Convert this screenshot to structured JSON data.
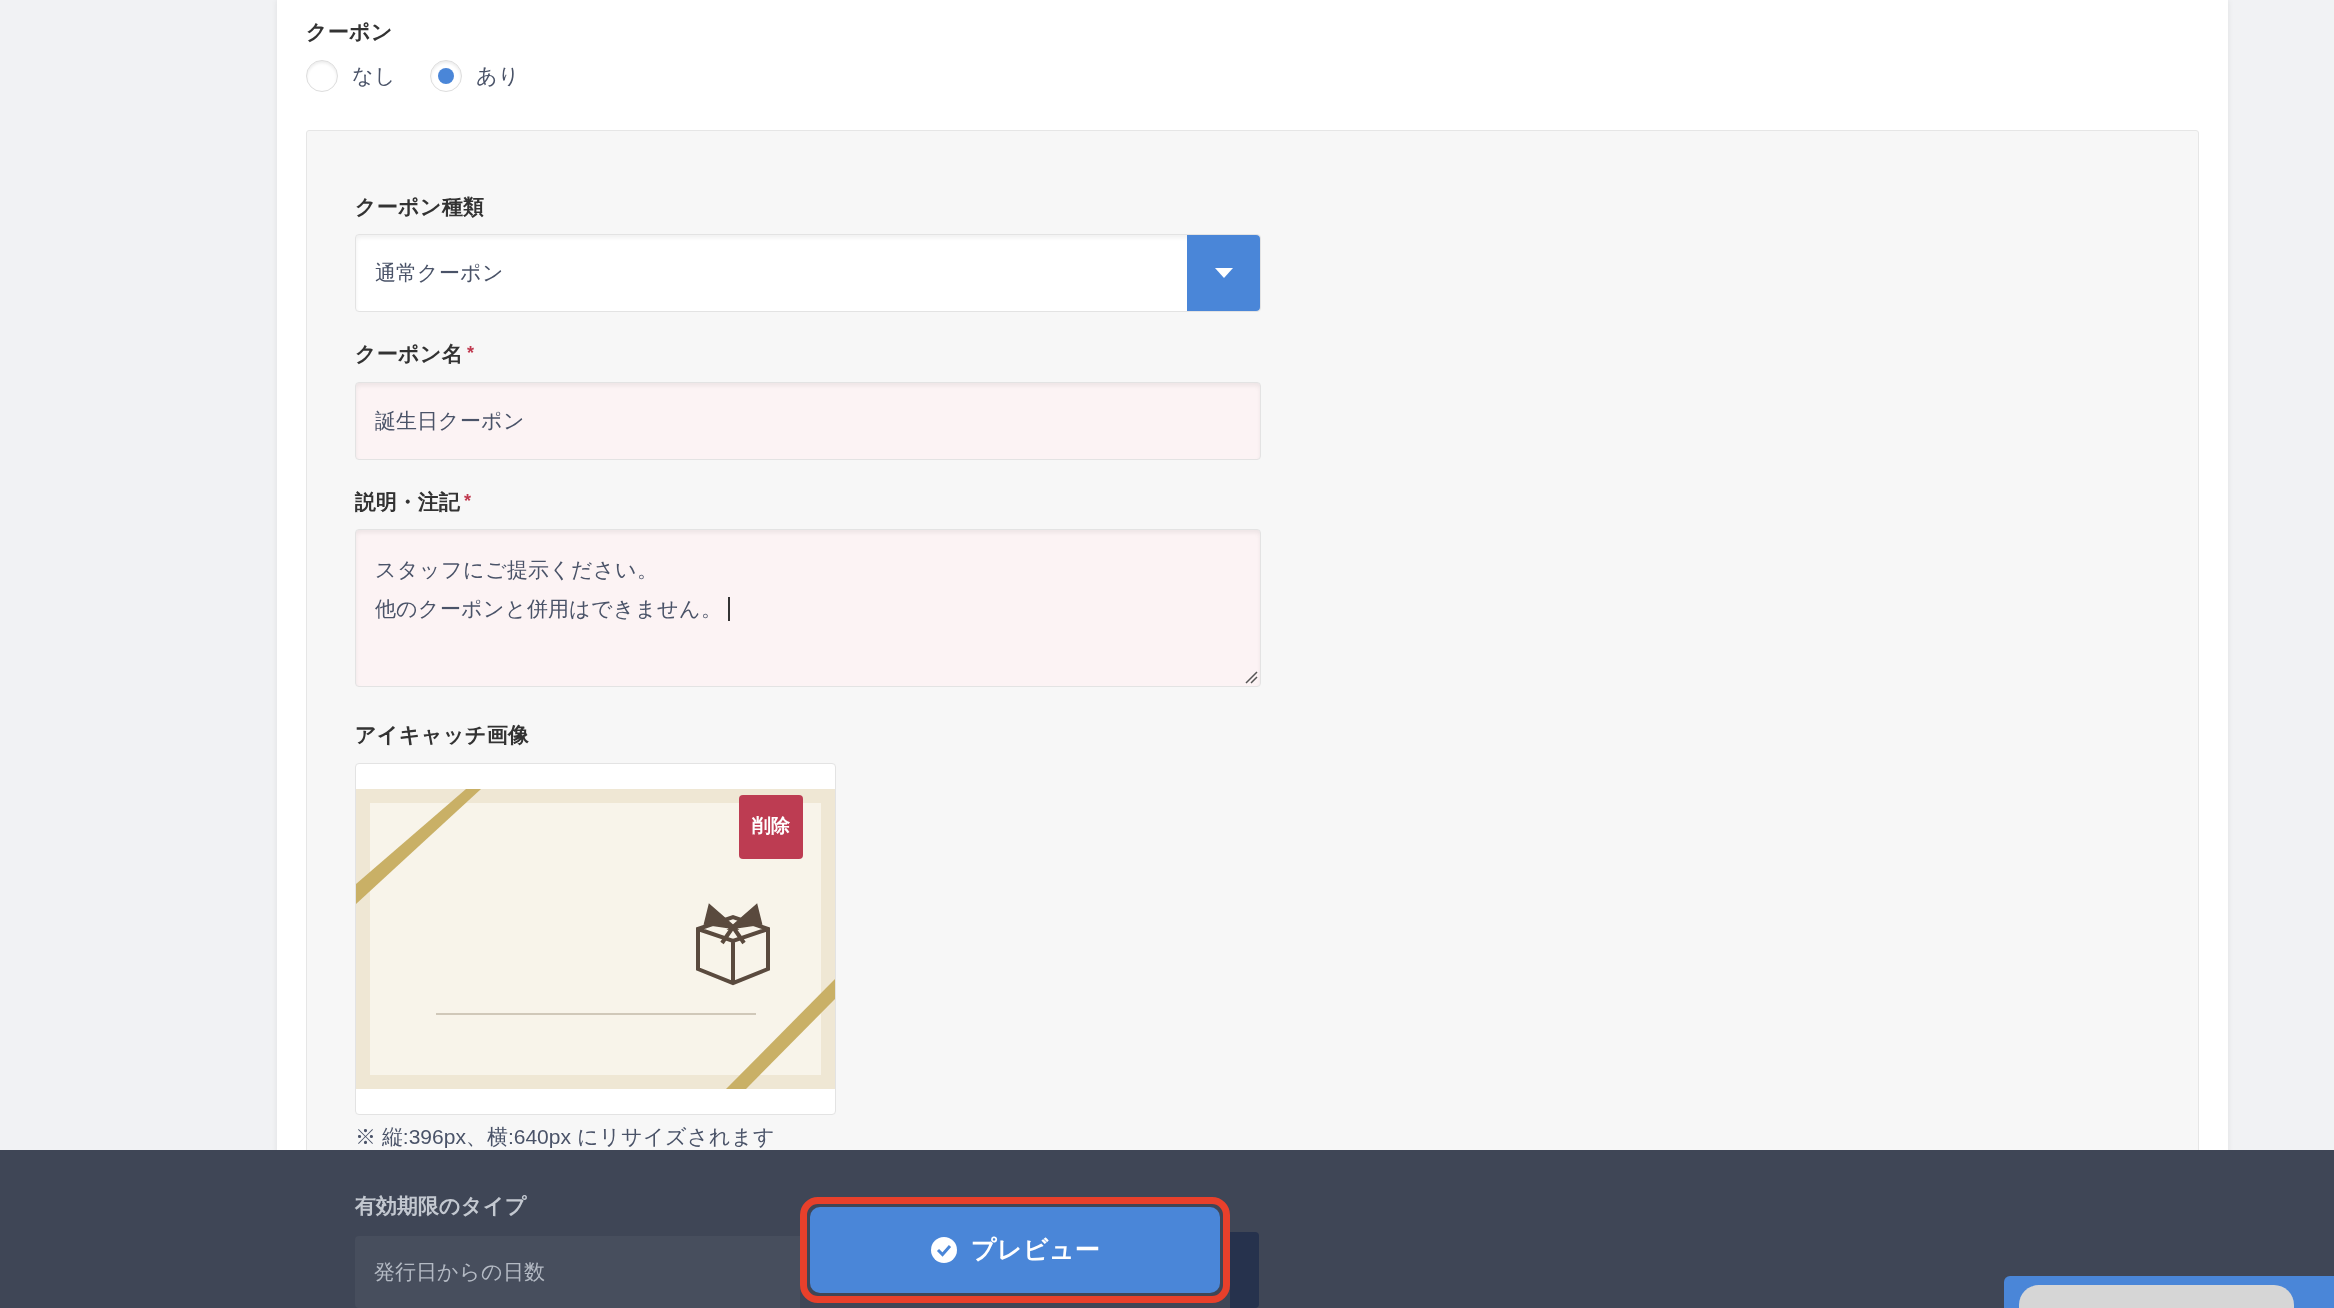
{
  "coupon": {
    "label": "クーポン",
    "options": [
      {
        "label": "なし",
        "selected": false
      },
      {
        "label": "あり",
        "selected": true
      }
    ]
  },
  "required_mark": "*",
  "fields": [
    {
      "kind": "select",
      "label": "クーポン種類",
      "required": false,
      "value": "通常クーポン"
    },
    {
      "kind": "input",
      "label": "クーポン名",
      "required": true,
      "value": "誕生日クーポン"
    },
    {
      "kind": "textarea",
      "label": "説明・注記",
      "required": true,
      "lines": [
        "スタッフにご提示ください。",
        "他のクーポンと併用はできません。"
      ]
    },
    {
      "kind": "image",
      "label": "アイキャッチ画像",
      "required": false,
      "delete_button": "削除",
      "note": "※ 縦:396px、横:640px にリサイズされます"
    },
    {
      "kind": "select",
      "label": "有効期限のタイプ",
      "required": false,
      "value": "発行日からの日数"
    }
  ],
  "preview_button": "プレビュー"
}
